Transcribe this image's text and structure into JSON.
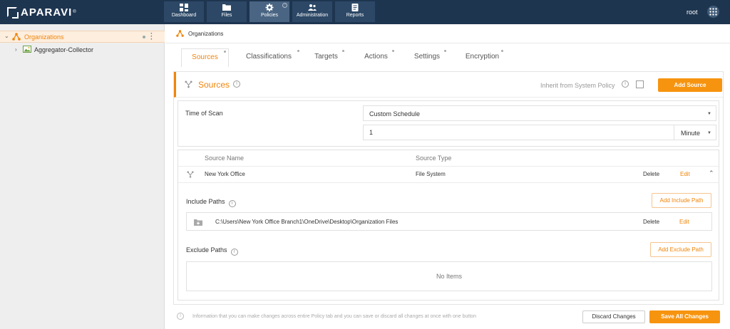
{
  "app": {
    "brand": "APARAVI",
    "user": "root"
  },
  "nav": [
    {
      "label": "Dashboard",
      "icon": "dashboard-icon"
    },
    {
      "label": "Files",
      "icon": "folder-icon"
    },
    {
      "label": "Policies",
      "icon": "gear-icon",
      "active": true,
      "badge": "?"
    },
    {
      "label": "Administration",
      "icon": "users-icon"
    },
    {
      "label": "Reports",
      "icon": "reports-icon"
    }
  ],
  "sidebar": {
    "root": {
      "label": "Organizations",
      "icon": "organization-icon"
    },
    "children": [
      {
        "label": "Aggregator-Collector",
        "icon": "aggregator-icon"
      }
    ]
  },
  "breadcrumb": {
    "label": "Organizations"
  },
  "tabs": [
    {
      "label": "Sources",
      "active": true
    },
    {
      "label": "Classifications"
    },
    {
      "label": "Targets"
    },
    {
      "label": "Actions"
    },
    {
      "label": "Settings"
    },
    {
      "label": "Encryption"
    }
  ],
  "panel": {
    "title": "Sources",
    "inherit_label": "Inherit from System Policy",
    "add_source": "Add Source",
    "time_of_scan_label": "Time of Scan",
    "schedule_value": "Custom Schedule",
    "interval_value": "1",
    "interval_unit": "Minute"
  },
  "sources_table": {
    "headers": {
      "name": "Source Name",
      "type": "Source Type"
    },
    "rows": [
      {
        "name": "New York Office",
        "type": "File System",
        "delete": "Delete",
        "edit": "Edit"
      }
    ]
  },
  "include": {
    "label": "Include Paths",
    "add": "Add Include Path",
    "paths": [
      {
        "path": "C:\\Users\\New York Office Branch1\\OneDrive\\Desktop\\Organization Files",
        "delete": "Delete",
        "edit": "Edit"
      }
    ]
  },
  "exclude": {
    "label": "Exclude Paths",
    "add": "Add Exclude Path",
    "empty": "No Items"
  },
  "footer": {
    "info": "Information that you can make changes across entire Policy tab and you can save or discard all changes at once with one button",
    "discard": "Discard Changes",
    "save": "Save All Changes"
  },
  "colors": {
    "accent": "#f0850a",
    "topbar": "#1e3550",
    "button": "#f7940f"
  }
}
